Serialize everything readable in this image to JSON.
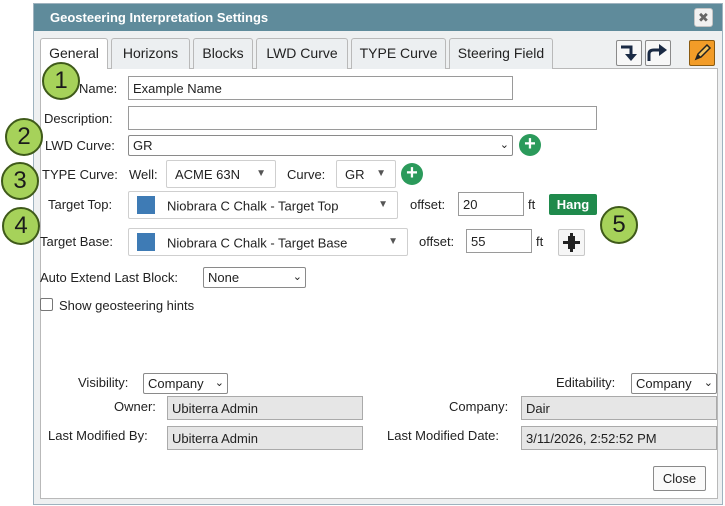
{
  "dialog": {
    "title": "Geosteering Interpretation Settings",
    "close_glyph": "✖"
  },
  "tabs": [
    "General",
    "Horizons",
    "Blocks",
    "LWD Curve",
    "TYPE Curve",
    "Steering Field"
  ],
  "form": {
    "name_label": "Name:",
    "name_value": "Example Name",
    "description_label": "Description:",
    "description_value": "",
    "lwd_label": "LWD Curve:",
    "lwd_value": "GR",
    "type_label": "TYPE Curve:",
    "well_label": "Well:",
    "well_value": "ACME 63N",
    "curve_label": "Curve:",
    "curve_value": "GR",
    "target_top_label": "Target Top:",
    "target_top_value": "Niobrara C Chalk - Target Top",
    "offset_label": "offset:",
    "target_top_offset": "20",
    "unit_ft": "ft",
    "hang_label": "Hang",
    "target_base_label": "Target Base:",
    "target_base_value": "Niobrara C Chalk - Target Base",
    "target_base_offset": "55",
    "auto_extend_label": "Auto Extend Last Block:",
    "auto_extend_value": "None",
    "hints_label": "Show geosteering hints",
    "hints_checked": false
  },
  "meta": {
    "visibility_label": "Visibility:",
    "visibility_value": "Company",
    "editability_label": "Editability:",
    "editability_value": "Company",
    "owner_label": "Owner:",
    "owner_value": "Ubiterra Admin",
    "company_label": "Company:",
    "company_value": "Dair",
    "modified_by_label": "Last Modified By:",
    "modified_by_value": "Ubiterra Admin",
    "modified_date_label": "Last Modified Date:",
    "modified_date_value": "3/11/2026, 2:52:52 PM"
  },
  "footer": {
    "close_label": "Close"
  },
  "callouts": [
    "1",
    "2",
    "3",
    "4",
    "5"
  ],
  "colors": {
    "titlebar": "#5f8b9b",
    "accent_green": "#1f8a4c",
    "swatch_blue": "#3e7bb5",
    "callout_green": "#a6d25a",
    "edit_orange": "#f29c28"
  },
  "icons": {
    "add": "plus-circle-icon",
    "import": "import-arrow-icon",
    "share": "share-arrow-icon",
    "edit": "pencil-icon",
    "pin": "pin-icon",
    "dropdown": "chevron-down-icon"
  }
}
